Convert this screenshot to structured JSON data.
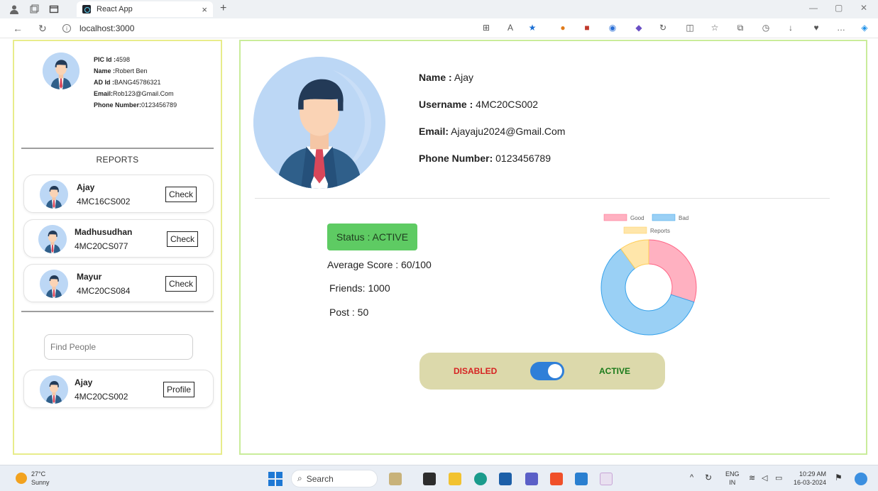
{
  "browser": {
    "tab_title": "React App",
    "tab_close": "×",
    "new_tab": "+",
    "url": "localhost:3000",
    "win_min": "—",
    "win_max": "▢",
    "win_close": "✕"
  },
  "admin": {
    "pic_id_label": "PIC Id :",
    "pic_id": "4598",
    "name_label": "Name :",
    "name": "Robert Ben",
    "ad_id_label": "AD Id :",
    "ad_id": "BANG45786321",
    "email_label": "Email:",
    "email": "Rob123@Gmail.Com",
    "phone_label": "Phone Number:",
    "phone": "0123456789"
  },
  "reports": {
    "title": "REPORTS",
    "items": [
      {
        "name": "Ajay",
        "id": "4MC16CS002",
        "button": "Check"
      },
      {
        "name": "Madhusudhan",
        "id": "4MC20CS077",
        "button": "Check"
      },
      {
        "name": "Mayur",
        "id": "4MC20CS084",
        "button": "Check"
      }
    ]
  },
  "find": {
    "placeholder": "Find People",
    "result": {
      "name": "Ajay",
      "id": "4MC20CS002",
      "button": "Profile"
    }
  },
  "profile": {
    "name_label": "Name :",
    "name": "Ajay",
    "username_label": "Username :",
    "username": "4MC20CS002",
    "email_label": "Email:",
    "email": "Ajayaju2024@Gmail.Com",
    "phone_label": "Phone Number:",
    "phone": "0123456789"
  },
  "stats": {
    "status": "Status : ACTIVE",
    "average_score": "Average Score : 60/100",
    "friends": "Friends: 1000",
    "post": "Post : 50"
  },
  "chart_data": {
    "type": "pie",
    "categories": [
      "Good",
      "Bad",
      "Reports"
    ],
    "values": [
      30,
      60,
      10
    ],
    "colors": [
      "#ffb1c1",
      "#9ad0f5",
      "#ffe6aa"
    ],
    "borders": [
      "#ff6384",
      "#36a2eb",
      "#ffcd56"
    ],
    "legend": "top"
  },
  "toggle": {
    "off_label": "DISABLED",
    "on_label": "ACTIVE",
    "state": "on"
  },
  "taskbar": {
    "temp": "27°C",
    "weather": "Sunny",
    "search": "Search",
    "lang1": "ENG",
    "lang2": "IN",
    "time": "10:29 AM",
    "date": "16-03-2024"
  }
}
